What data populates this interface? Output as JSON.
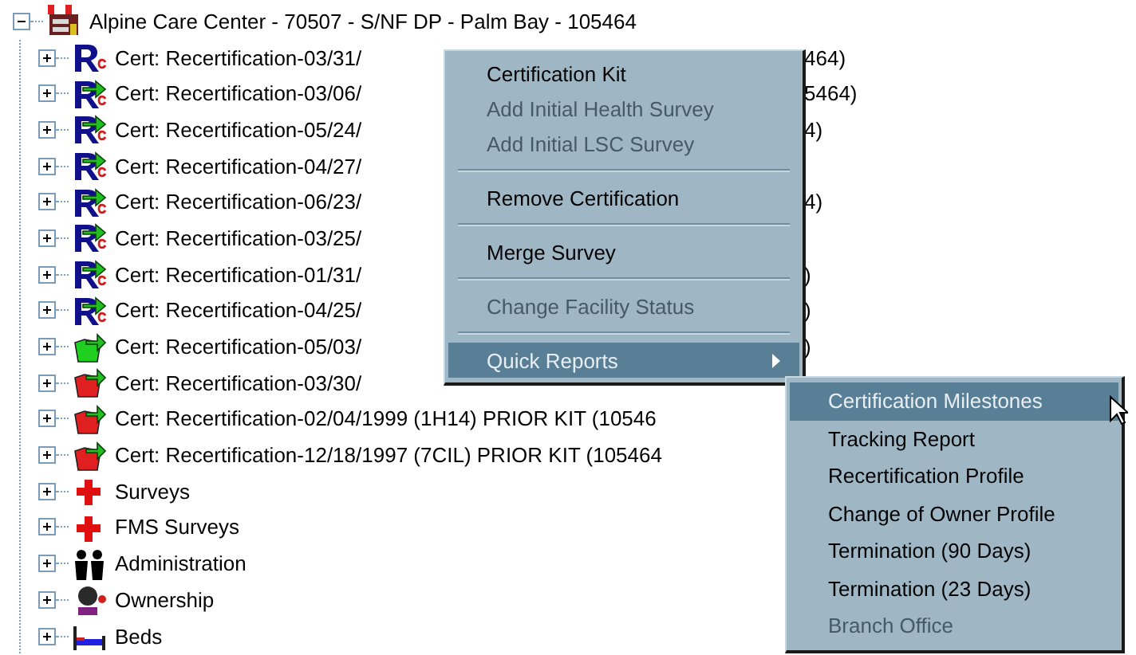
{
  "tree": {
    "label": "Alpine Care Center - 70507 - S/NF DP - Palm Bay - 105464",
    "kind": "facility",
    "expanded": true,
    "children": [
      {
        "label": "Cert: Recertification-03/31/",
        "tail": "464)",
        "kind": "recert",
        "expanded": false
      },
      {
        "label": "Cert: Recertification-03/06/",
        "tail": "5464)",
        "kind": "recert-arrow",
        "expanded": false
      },
      {
        "label": "Cert: Recertification-05/24/",
        "tail": "4)",
        "kind": "recert-arrow",
        "expanded": false
      },
      {
        "label": "Cert: Recertification-04/27/",
        "kind": "recert-arrow",
        "expanded": false
      },
      {
        "label": "Cert: Recertification-06/23/",
        "tail": "4)",
        "kind": "recert-arrow",
        "expanded": false
      },
      {
        "label": "Cert: Recertification-03/25/",
        "kind": "recert-arrow",
        "expanded": false
      },
      {
        "label": "Cert: Recertification-01/31/",
        "tail": ")",
        "kind": "recert-arrow",
        "expanded": false
      },
      {
        "label": "Cert: Recertification-04/25/",
        "tail": ")",
        "kind": "recert-arrow",
        "expanded": false
      },
      {
        "label": "Cert: Recertification-05/03/",
        "tail": ")",
        "kind": "kit-green",
        "expanded": false
      },
      {
        "label": "Cert: Recertification-03/30/",
        "kind": "kit-red",
        "expanded": false
      },
      {
        "label": "Cert: Recertification-02/04/1999 (1H14) PRIOR KIT (10546",
        "kind": "kit-red",
        "expanded": false
      },
      {
        "label": "Cert: Recertification-12/18/1997 (7CIL) PRIOR KIT (105464",
        "kind": "kit-red",
        "expanded": false
      },
      {
        "label": "Surveys",
        "kind": "cross",
        "expanded": false
      },
      {
        "label": "FMS Surveys",
        "kind": "cross",
        "expanded": false
      },
      {
        "label": "Administration",
        "kind": "people",
        "expanded": false
      },
      {
        "label": "Ownership",
        "kind": "person",
        "expanded": false
      },
      {
        "label": "Beds",
        "kind": "bed",
        "expanded": false
      }
    ]
  },
  "context_menu": [
    {
      "kind": "item",
      "label": "Certification Kit",
      "disabled": false,
      "selected": false
    },
    {
      "kind": "item",
      "label": "Add Initial Health Survey",
      "disabled": true,
      "selected": false
    },
    {
      "kind": "item",
      "label": "Add Initial LSC Survey",
      "disabled": true,
      "selected": false
    },
    {
      "kind": "separator"
    },
    {
      "kind": "item",
      "label": "Remove Certification",
      "disabled": false,
      "selected": false
    },
    {
      "kind": "separator"
    },
    {
      "kind": "item",
      "label": "Merge Survey",
      "disabled": false,
      "selected": false
    },
    {
      "kind": "separator"
    },
    {
      "kind": "item",
      "label": "Change Facility Status",
      "disabled": true,
      "selected": false
    },
    {
      "kind": "separator"
    },
    {
      "kind": "submenu",
      "label": "Quick Reports",
      "disabled": false,
      "selected": true
    }
  ],
  "submenu": [
    {
      "label": "Certification Milestones",
      "disabled": false,
      "selected": true
    },
    {
      "label": "Tracking Report",
      "disabled": false,
      "selected": false
    },
    {
      "label": "Recertification Profile",
      "disabled": false,
      "selected": false
    },
    {
      "label": "Change of Owner Profile",
      "disabled": false,
      "selected": false
    },
    {
      "label": "Termination (90 Days)",
      "disabled": false,
      "selected": false
    },
    {
      "label": "Termination (23 Days)",
      "disabled": false,
      "selected": false
    },
    {
      "label": "Branch Office",
      "disabled": true,
      "selected": false
    }
  ]
}
